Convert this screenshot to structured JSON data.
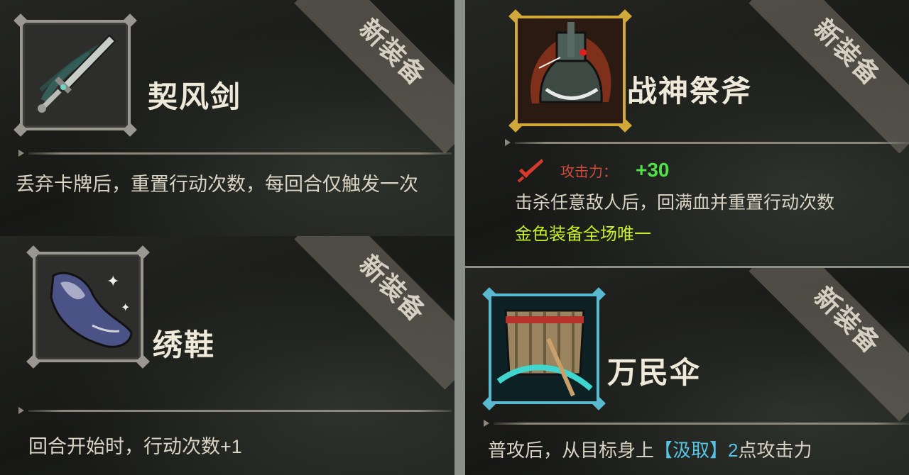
{
  "cards": [
    {
      "badge": "新装备",
      "name": "契风剑",
      "icon": "sword-icon",
      "description": "丢弃卡牌后，重置行动次数，每回合仅触发一次"
    },
    {
      "badge": "新装备",
      "name": "战神祭斧",
      "icon": "battle-axe-icon",
      "stat_icon": "red-sword-icon",
      "stat_label": "攻击力：",
      "stat_value": "+30",
      "description": "击杀任意敌人后，回满血并重置行动次数",
      "note": "金色装备全场唯一"
    },
    {
      "badge": "新装备",
      "name": "绣鞋",
      "icon": "embroidered-shoe-icon",
      "description": "回合开始时，行动次数+1"
    },
    {
      "badge": "新装备",
      "name": "万民伞",
      "icon": "umbrella-icon",
      "description_pre": "普攻后，从目标身上",
      "keyword": "【汲取】",
      "highlight_num": "2",
      "description_post": "点攻击力"
    }
  ],
  "colors": {
    "gold_frame": "#d1a93a",
    "blue_frame": "#58b9cf",
    "stat_label": "#d24a3c",
    "stat_value": "#4fe04a",
    "gold_note": "#c7ef2a",
    "keyword": "#58c4e4"
  }
}
